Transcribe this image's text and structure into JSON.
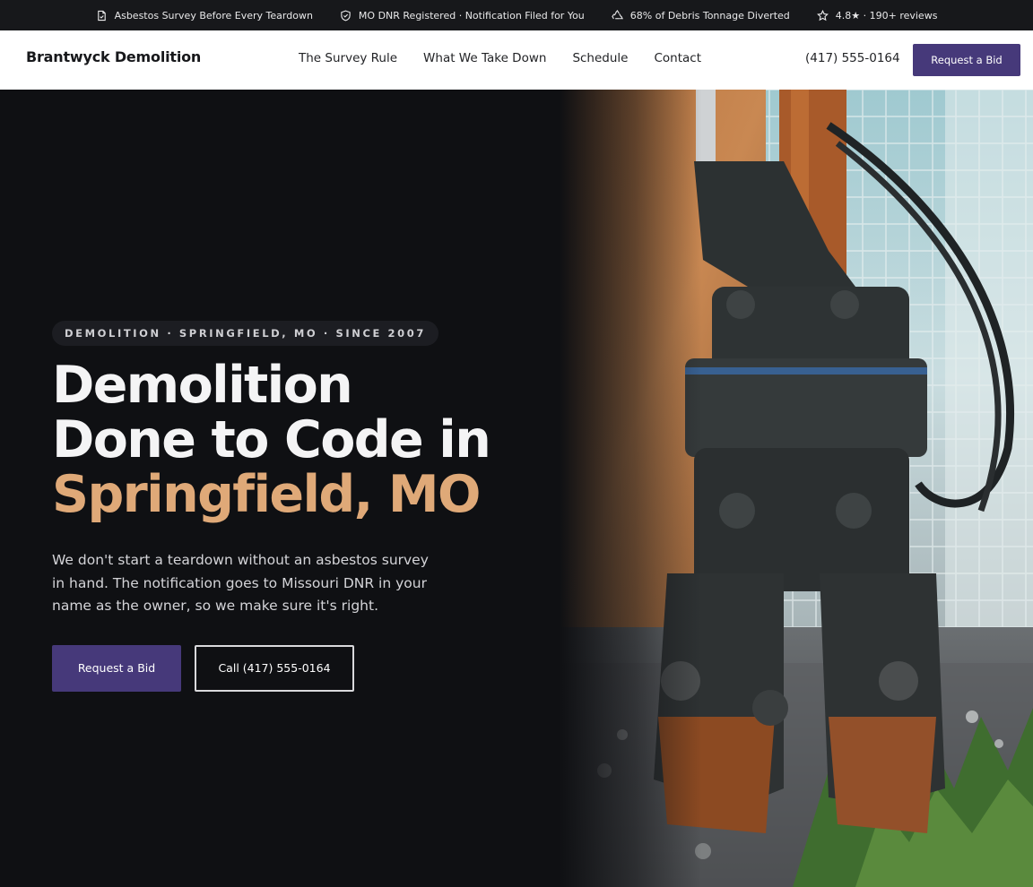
{
  "topbar": {
    "items": [
      {
        "icon": "document-check-icon",
        "text": "Asbestos Survey Before Every Teardown"
      },
      {
        "icon": "shield-check-icon",
        "text": "MO DNR Registered · Notification Filed for You"
      },
      {
        "icon": "recycle-icon",
        "text": "68% of Debris Tonnage Diverted"
      },
      {
        "icon": "star-icon",
        "text": "4.8★ · 190+ reviews"
      }
    ]
  },
  "header": {
    "brand": "Brantwyck Demolition",
    "nav": [
      "The Survey Rule",
      "What We Take Down",
      "Schedule",
      "Contact"
    ],
    "phone": "(417) 555-0164",
    "cta_label": "Request a Bid"
  },
  "hero": {
    "eyebrow": "DEMOLITION · SPRINGFIELD, MO · SINCE 2007",
    "headline_line1": "Demolition",
    "headline_line2": "Done to Code in",
    "headline_accent": "Springfield, MO",
    "lede": "We don't start a teardown without an asbestos survey in hand. The notification goes to Missouri DNR in your name as the owner, so we make sure it's right.",
    "primary_cta": "Request a Bid",
    "secondary_cta": "Call (417) 555-0164",
    "photo_icon": "excavator-shear-photo"
  },
  "colors": {
    "accent": "#46397a",
    "headline_accent": "#dfa978",
    "hero_bg": "#0f1013",
    "topbar_bg": "#17181b"
  }
}
